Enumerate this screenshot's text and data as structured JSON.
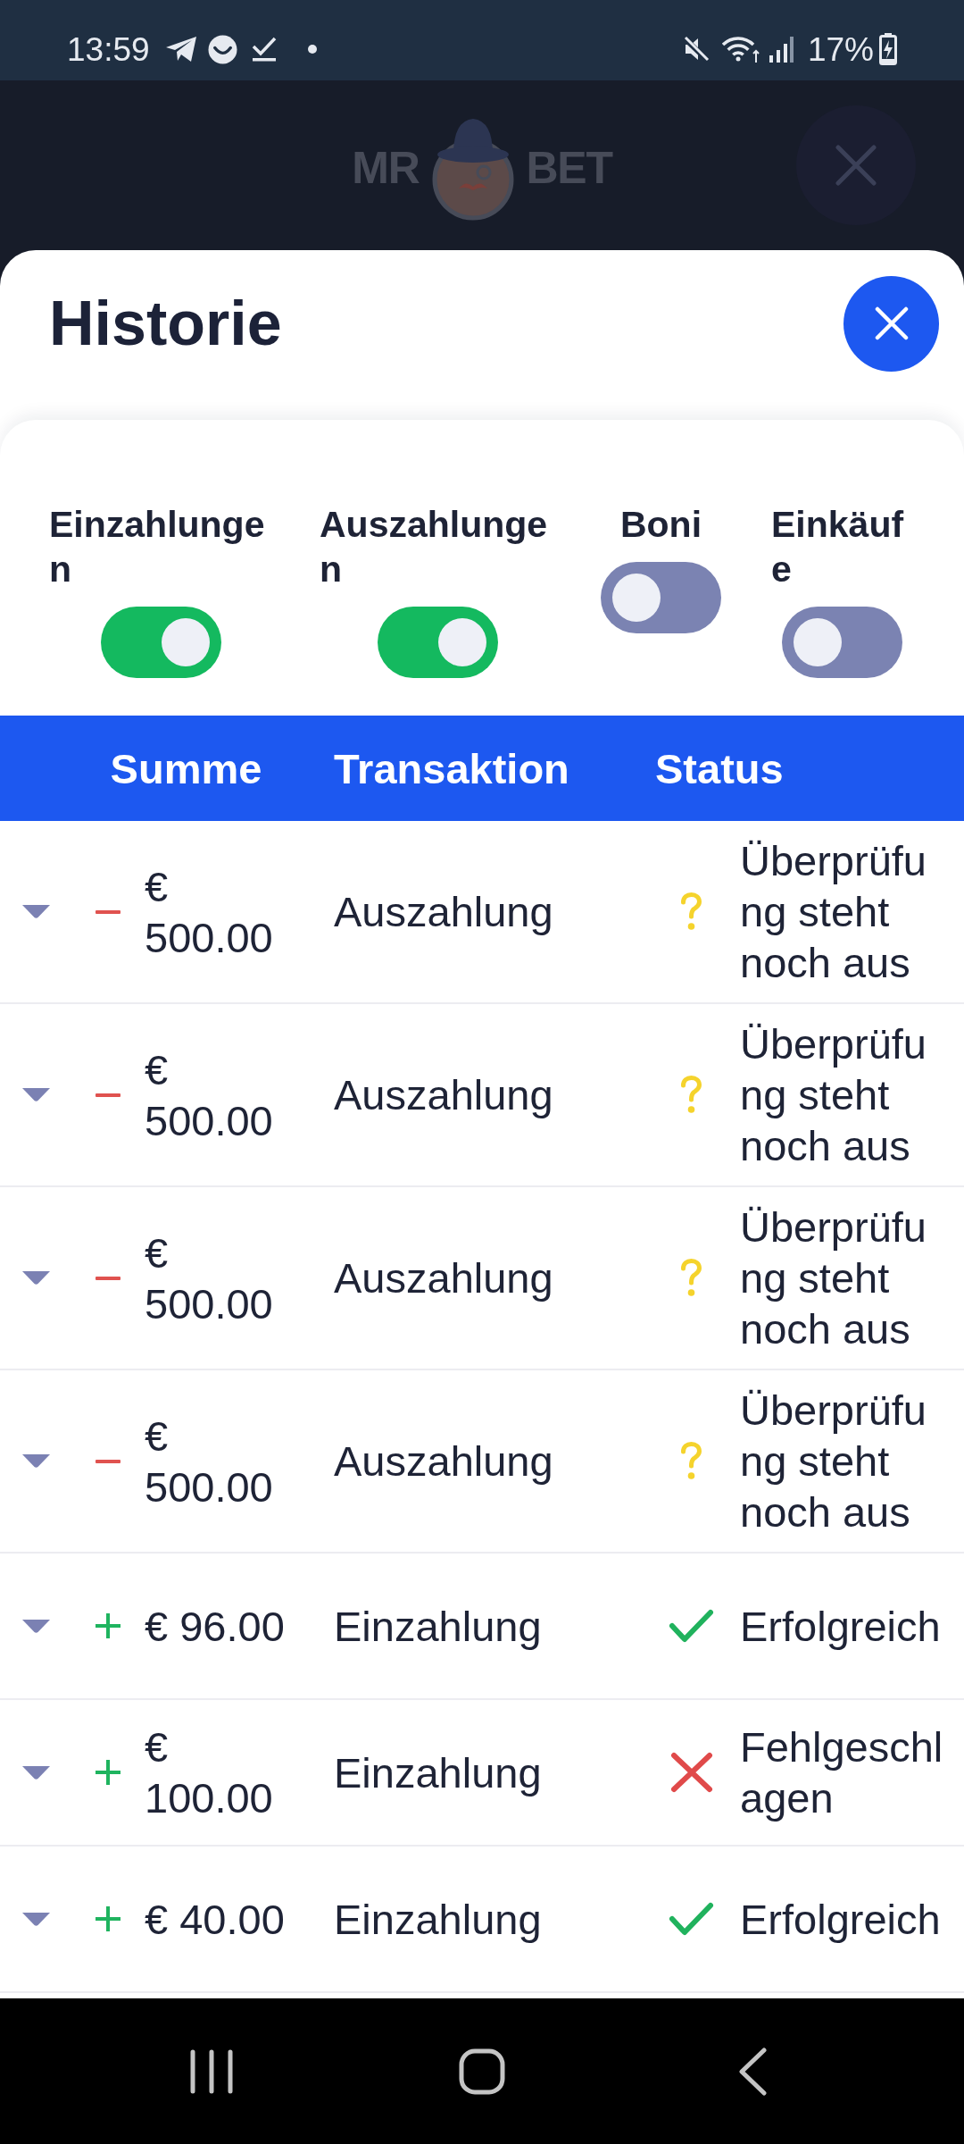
{
  "status_bar": {
    "time": "13:59",
    "battery": "17%"
  },
  "app_header": {
    "logo_words": [
      "MR",
      "BET"
    ]
  },
  "sheet": {
    "title": "Historie"
  },
  "filters": [
    {
      "label": "Einzahlungen",
      "on": true
    },
    {
      "label": "Auszahlungen",
      "on": true
    },
    {
      "label": "Boni",
      "on": false
    },
    {
      "label": "Einkäufe",
      "on": false
    }
  ],
  "table": {
    "columns": [
      "Summe",
      "Transaktion",
      "Status"
    ],
    "rows": [
      {
        "expanded": false,
        "amount": {
          "kind": "minus",
          "text": "€ 500.00"
        },
        "transaction": "Auszahlung",
        "status": {
          "kind": "pending",
          "text": "Überprüfung steht noch aus"
        }
      },
      {
        "expanded": false,
        "amount": {
          "kind": "minus",
          "text": "€ 500.00"
        },
        "transaction": "Auszahlung",
        "status": {
          "kind": "pending",
          "text": "Überprüfung steht noch aus"
        }
      },
      {
        "expanded": false,
        "amount": {
          "kind": "minus",
          "text": "€ 500.00"
        },
        "transaction": "Auszahlung",
        "status": {
          "kind": "pending",
          "text": "Überprüfung steht noch aus"
        }
      },
      {
        "expanded": false,
        "amount": {
          "kind": "minus",
          "text": "€ 500.00"
        },
        "transaction": "Auszahlung",
        "status": {
          "kind": "pending",
          "text": "Überprüfung steht noch aus"
        }
      },
      {
        "expanded": false,
        "amount": {
          "kind": "plus",
          "text": "€ 96.00"
        },
        "transaction": "Einzahlung",
        "status": {
          "kind": "success",
          "text": "Erfolgreich"
        }
      },
      {
        "expanded": false,
        "amount": {
          "kind": "plus",
          "text": "€ 100.00"
        },
        "transaction": "Einzahlung",
        "status": {
          "kind": "failed",
          "text": "Fehlgeschlagen"
        }
      },
      {
        "expanded": false,
        "amount": {
          "kind": "plus",
          "text": "€ 40.00"
        },
        "transaction": "Einzahlung",
        "status": {
          "kind": "success",
          "text": "Erfolgreich"
        }
      }
    ]
  }
}
